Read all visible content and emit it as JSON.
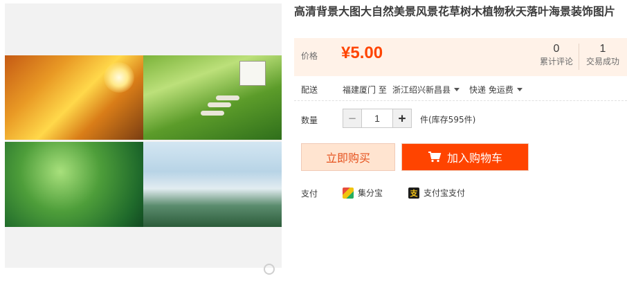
{
  "product": {
    "title": "高清背景大图大自然美景风景花草树木植物秋天落叶海景装饰图片"
  },
  "price": {
    "label": "价格",
    "value": "¥5.00"
  },
  "stats": {
    "reviews_count": "0",
    "reviews_label": "累计评论",
    "sales_count": "1",
    "sales_label": "交易成功"
  },
  "delivery": {
    "label": "配送",
    "from": "福建厦门",
    "to_word": "至",
    "destination": "浙江绍兴新昌县",
    "method": "快递 免运费"
  },
  "quantity": {
    "label": "数量",
    "value": "1",
    "minus": "−",
    "plus": "+",
    "stock_text": "件(库存595件)"
  },
  "actions": {
    "buy_now": "立即购买",
    "add_to_cart": "加入购物车"
  },
  "payment": {
    "label": "支付",
    "methods": [
      {
        "name": "集分宝",
        "icon": "jifenbao-icon"
      },
      {
        "name": "支付宝支付",
        "icon": "alipay-icon"
      }
    ]
  },
  "colors": {
    "accent": "#ff4400",
    "price_bg": "#fff2e8",
    "buy_bg": "#ffe4d0"
  }
}
